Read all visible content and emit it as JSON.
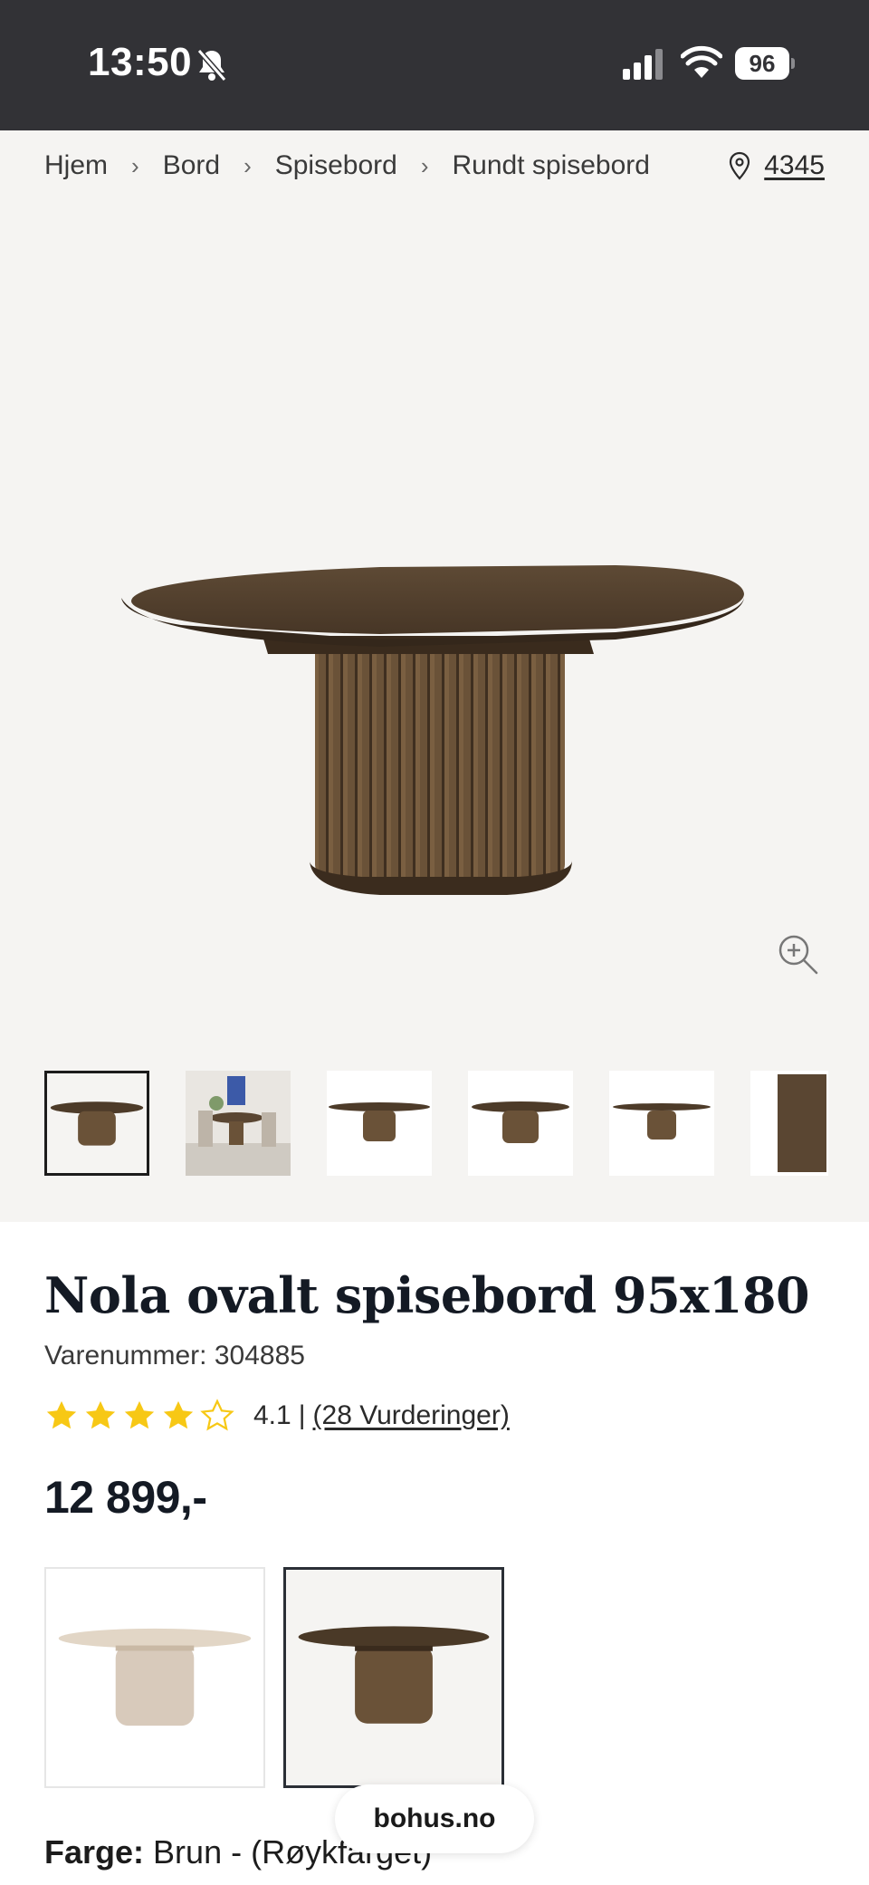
{
  "status_bar": {
    "time": "13:50",
    "battery": "96"
  },
  "breadcrumb": {
    "items": [
      "Hjem",
      "Bord",
      "Spisebord",
      "Rundt spisebord"
    ],
    "separator": "›"
  },
  "store": {
    "number": "4345"
  },
  "gallery": {
    "thumbnail_count": 6,
    "selected_index": 0
  },
  "product": {
    "title": "Nola ovalt spisebord 95x180",
    "sku_label": "Varenummer:",
    "sku_value": "304885",
    "rating": 4.1,
    "rating_text": "4.1",
    "rating_separator": "|",
    "reviews_text": "(28 Vurderinger)",
    "price": "12 899,-"
  },
  "variants": [
    {
      "name": "light-oak",
      "selected": false
    },
    {
      "name": "brown-smoked",
      "selected": true
    }
  ],
  "color": {
    "label": "Farge:",
    "value": "Brun - (Røykfarget)"
  },
  "browser": {
    "domain": "bohus.no"
  },
  "colors": {
    "status_bar": "#323236",
    "gallery_bg": "#f5f4f2",
    "star": "#f7c815",
    "wood_dark": "#5a4632",
    "wood_light": "#e2d6c6"
  }
}
